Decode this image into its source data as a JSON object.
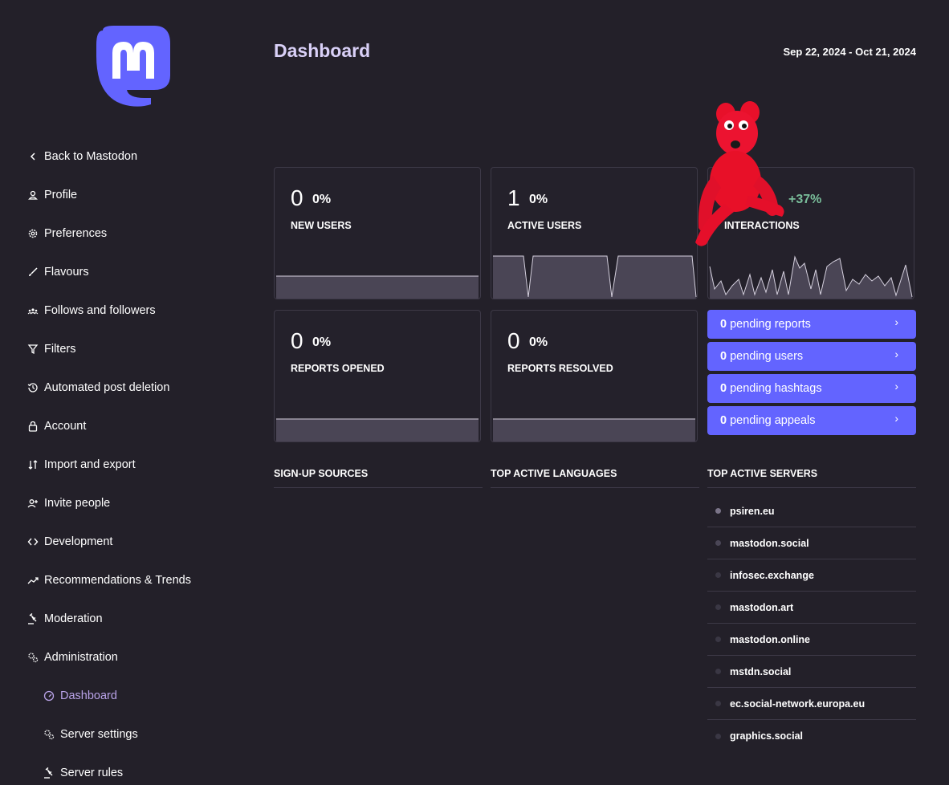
{
  "sidebar": {
    "items": [
      {
        "label": "Back to Mastodon",
        "icon": "chevron-left-icon"
      },
      {
        "label": "Profile",
        "icon": "user-icon"
      },
      {
        "label": "Preferences",
        "icon": "gear-icon"
      },
      {
        "label": "Flavours",
        "icon": "brush-icon"
      },
      {
        "label": "Follows and followers",
        "icon": "users-icon"
      },
      {
        "label": "Filters",
        "icon": "filter-icon"
      },
      {
        "label": "Automated post deletion",
        "icon": "history-icon"
      },
      {
        "label": "Account",
        "icon": "lock-icon"
      },
      {
        "label": "Import and export",
        "icon": "import-export-icon"
      },
      {
        "label": "Invite people",
        "icon": "user-plus-icon"
      },
      {
        "label": "Development",
        "icon": "code-icon"
      },
      {
        "label": "Recommendations & Trends",
        "icon": "trending-icon"
      },
      {
        "label": "Moderation",
        "icon": "gavel-icon"
      },
      {
        "label": "Administration",
        "icon": "gears-icon"
      },
      {
        "label": "Dashboard",
        "icon": "gauge-icon"
      },
      {
        "label": "Server settings",
        "icon": "gears-icon"
      },
      {
        "label": "Server rules",
        "icon": "gavel-icon"
      }
    ]
  },
  "header": {
    "title": "Dashboard",
    "date_range": "Sep 22, 2024 - Oct 21, 2024"
  },
  "metrics": [
    {
      "value": "0",
      "change": "0%",
      "label": "NEW USERS"
    },
    {
      "value": "1",
      "change": "0%",
      "label": "ACTIVE USERS"
    },
    {
      "value": "",
      "change": "+37%",
      "label": "INTERACTIONS"
    },
    {
      "value": "0",
      "change": "0%",
      "label": "REPORTS OPENED"
    },
    {
      "value": "0",
      "change": "0%",
      "label": "REPORTS RESOLVED"
    }
  ],
  "pending": [
    {
      "count": "0",
      "label": "pending reports"
    },
    {
      "count": "0",
      "label": "pending users"
    },
    {
      "count": "0",
      "label": "pending hashtags"
    },
    {
      "count": "0",
      "label": "pending appeals"
    }
  ],
  "sections": {
    "signup_sources": "SIGN-UP SOURCES",
    "top_languages": "TOP ACTIVE LANGUAGES",
    "top_servers": "TOP ACTIVE SERVERS"
  },
  "servers": [
    "psiren.eu",
    "mastodon.social",
    "infosec.exchange",
    "mastodon.art",
    "mastodon.online",
    "mstdn.social",
    "ec.social-network.europa.eu",
    "graphics.social"
  ],
  "colors": {
    "background": "#232029",
    "accent": "#6364ff",
    "active_nav": "#b9a3e8",
    "title": "#d9d0f7",
    "positive": "#79bd9a"
  }
}
